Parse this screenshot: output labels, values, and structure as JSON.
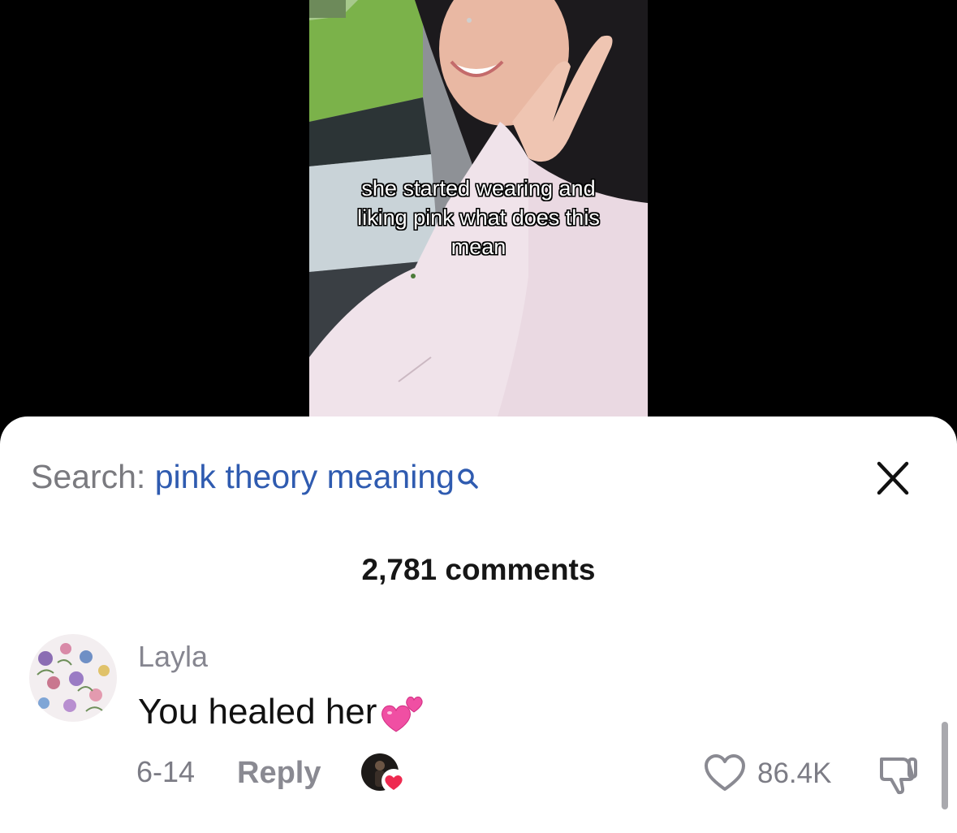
{
  "video": {
    "caption_lines": [
      "she started wearing and",
      "liking pink what does this",
      "mean"
    ]
  },
  "search": {
    "prefix": "Search:",
    "query": "pink theory meaning",
    "icon": "search-icon"
  },
  "header": {
    "comment_count": "2,781 comments",
    "close_icon": "close-icon"
  },
  "comment": {
    "username": "Layla",
    "text": "You healed her",
    "emoji": "two-hearts-emoji",
    "date": "6-14",
    "reply_label": "Reply",
    "like_count": "86.4K",
    "icons": [
      "heart-outline-icon",
      "thumbs-down-icon"
    ]
  },
  "colors": {
    "search_query": "#2f5bb0",
    "heart_badge": "#ee2a50",
    "emoji_pink": "#f04fa3"
  }
}
